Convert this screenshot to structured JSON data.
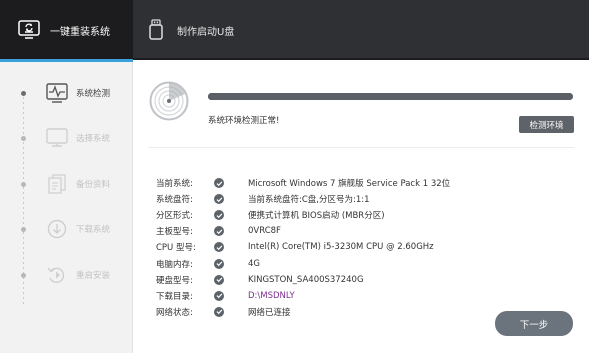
{
  "header": {
    "tabs": [
      {
        "label": "一键重装系统",
        "icon": "monitor-refresh-icon",
        "active": true
      },
      {
        "label": "制作启动U盘",
        "icon": "usb-drive-icon",
        "active": false
      }
    ],
    "accent": "#3aa0dc",
    "background": "#2f3033"
  },
  "sidebar": {
    "steps": [
      {
        "label": "系统检测",
        "icon": "waveform-monitor-icon",
        "active": true
      },
      {
        "label": "选择系统",
        "icon": "monitor-icon",
        "active": false
      },
      {
        "label": "备份资料",
        "icon": "documents-icon",
        "active": false
      },
      {
        "label": "下载系统",
        "icon": "download-icon",
        "active": false
      },
      {
        "label": "重启安装",
        "icon": "restart-icon",
        "active": false
      }
    ]
  },
  "detection": {
    "progress": 1.0,
    "status": "系统环境检测正常!",
    "detect_button": "检测环境"
  },
  "system_info": [
    {
      "label": "当前系统:",
      "value": "Microsoft Windows 7 旗舰版 Service Pack 1 32位",
      "link": false
    },
    {
      "label": "系统盘符:",
      "value": "当前系统盘符:C盘,分区号为:1:1",
      "link": false
    },
    {
      "label": "分区形式:",
      "value": "便携式计算机 BIOS启动 (MBR分区)",
      "link": false
    },
    {
      "label": "主板型号:",
      "value": "0VRC8F",
      "link": false
    },
    {
      "label": "CPU 型号:",
      "value": "Intel(R) Core(TM) i5-3230M CPU @ 2.60GHz",
      "link": false
    },
    {
      "label": "电脑内存:",
      "value": "4G",
      "link": false
    },
    {
      "label": "硬盘型号:",
      "value": "KINGSTON_SA400S37240G",
      "link": false
    },
    {
      "label": "下载目录:",
      "value": "D:\\MSDNLY",
      "link": true
    },
    {
      "label": "网络状态:",
      "value": "网络已连接",
      "link": false
    }
  ],
  "footer": {
    "next_button": "下一步"
  }
}
